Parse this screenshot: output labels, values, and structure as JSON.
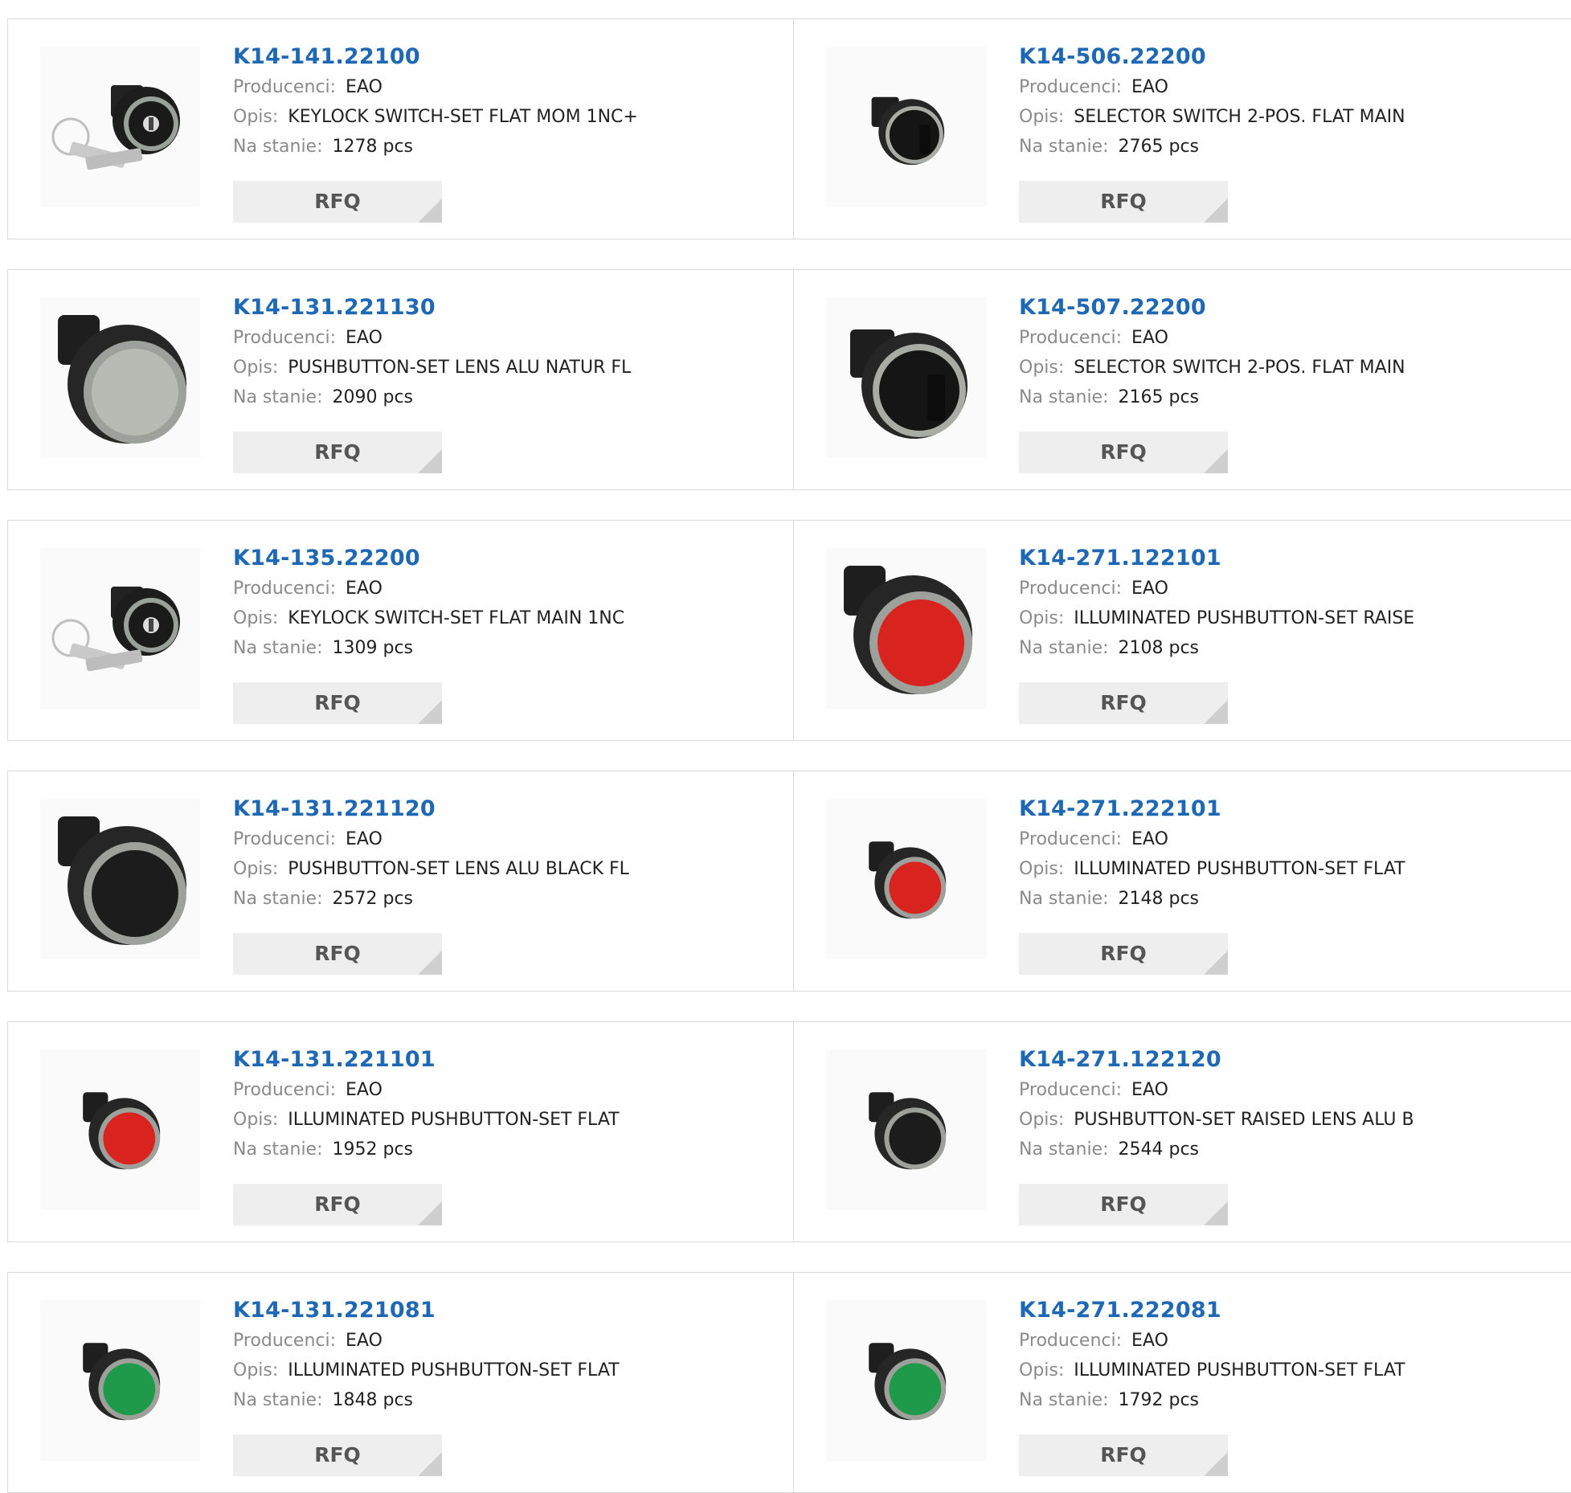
{
  "labels": {
    "manufacturer": "Producenci:",
    "description": "Opis:",
    "stock": "Na stanie:",
    "rfq": "RFQ"
  },
  "products": [
    {
      "part": "K14-141.22100",
      "manufacturer": "EAO",
      "description": "KEYLOCK SWITCH-SET FLAT MOM 1NC+",
      "stock": "1278 pcs",
      "image": "keylock-switch-with-keys"
    },
    {
      "part": "K14-506.22200",
      "manufacturer": "EAO",
      "description": "SELECTOR SWITCH 2-POS. FLAT MAIN",
      "stock": "2765 pcs",
      "image": "selector-switch-small"
    },
    {
      "part": "K14-131.221130",
      "manufacturer": "EAO",
      "description": "PUSHBUTTON-SET LENS ALU NATUR FL",
      "stock": "2090 pcs",
      "image": "pushbutton-grey-large"
    },
    {
      "part": "K14-507.22200",
      "manufacturer": "EAO",
      "description": "SELECTOR SWITCH 2-POS. FLAT MAIN",
      "stock": "2165 pcs",
      "image": "selector-switch-large"
    },
    {
      "part": "K14-135.22200",
      "manufacturer": "EAO",
      "description": "KEYLOCK SWITCH-SET FLAT MAIN 1NC",
      "stock": "1309 pcs",
      "image": "keylock-switch-with-keys"
    },
    {
      "part": "K14-271.122101",
      "manufacturer": "EAO",
      "description": "ILLUMINATED PUSHBUTTON-SET RAISE",
      "stock": "2108 pcs",
      "image": "pushbutton-red-large"
    },
    {
      "part": "K14-131.221120",
      "manufacturer": "EAO",
      "description": "PUSHBUTTON-SET LENS ALU BLACK FL",
      "stock": "2572 pcs",
      "image": "pushbutton-black-large"
    },
    {
      "part": "K14-271.222101",
      "manufacturer": "EAO",
      "description": "ILLUMINATED PUSHBUTTON-SET FLAT",
      "stock": "2148 pcs",
      "image": "pushbutton-red-small"
    },
    {
      "part": "K14-131.221101",
      "manufacturer": "EAO",
      "description": "ILLUMINATED PUSHBUTTON-SET FLAT",
      "stock": "1952 pcs",
      "image": "pushbutton-red-small"
    },
    {
      "part": "K14-271.122120",
      "manufacturer": "EAO",
      "description": "PUSHBUTTON-SET RAISED LENS ALU B",
      "stock": "2544 pcs",
      "image": "pushbutton-black-small"
    },
    {
      "part": "K14-131.221081",
      "manufacturer": "EAO",
      "description": "ILLUMINATED PUSHBUTTON-SET FLAT",
      "stock": "1848 pcs",
      "image": "pushbutton-green-small"
    },
    {
      "part": "K14-271.222081",
      "manufacturer": "EAO",
      "description": "ILLUMINATED PUSHBUTTON-SET FLAT",
      "stock": "1792 pcs",
      "image": "pushbutton-green-small"
    }
  ],
  "colors": {
    "title": "#1f68b4",
    "label": "#8a8a8a",
    "border": "#d9d9d9",
    "rfq_bg": "#eeeeee",
    "lens_red": "#d8231f",
    "lens_green": "#1e9a4a",
    "lens_grey": "#b7bbb4",
    "lens_black": "#1c1c1c"
  }
}
